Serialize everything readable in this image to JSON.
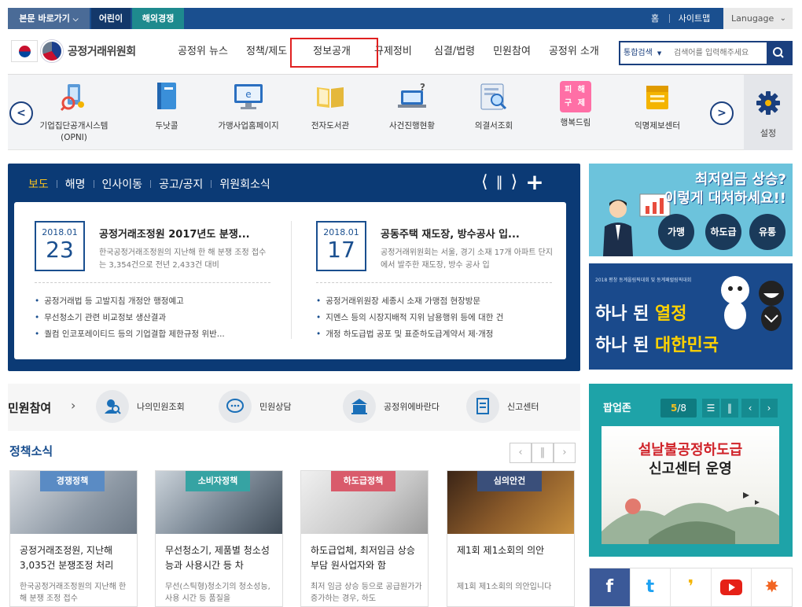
{
  "topbar": {
    "skip_label": "본문 바로가기",
    "kids_label": "어린이",
    "overseas_label": "해외경쟁",
    "home_label": "홈",
    "sitemap_label": "사이트맵",
    "language_label": "Lanugage"
  },
  "header": {
    "logo_text": "공정거래위원회",
    "nav": [
      "공정위 뉴스",
      "정책/제도",
      "정보공개",
      "규제정비",
      "심결/법령",
      "민원참여",
      "공정위 소개"
    ],
    "highlighted_nav": "정보공개",
    "search": {
      "scope": "통합검색",
      "placeholder": "검색어를 입력해주세요"
    }
  },
  "quick_links": {
    "items": [
      {
        "label": "기업집단공개시스템 (OPNI)",
        "icon": "building-search-icon"
      },
      {
        "label": "두낫콜",
        "icon": "book-icon"
      },
      {
        "label": "가맹사업홈페이지",
        "icon": "monitor-icon"
      },
      {
        "label": "전자도서관",
        "icon": "open-book-icon"
      },
      {
        "label": "사건진행현황",
        "icon": "laptop-question-icon"
      },
      {
        "label": "의결서조회",
        "icon": "document-search-icon"
      },
      {
        "label": "행복드림",
        "icon": "relief-icon",
        "glyph": "피 해 구 제"
      },
      {
        "label": "익명제보센터",
        "icon": "folder-icon"
      }
    ],
    "settings_label": "설정"
  },
  "news": {
    "tabs": [
      "보도",
      "해명",
      "인사이동",
      "공고/공지",
      "위원회소식"
    ],
    "active_tab": "보도",
    "articles": [
      {
        "year_month": "2018.01",
        "day": "23",
        "title": "공정거래조정원 2017년도 분쟁...",
        "summary": "한국공정거래조정원의 지난해 한 해 분쟁 조정 접수는 3,354건으로 전년 2,433건 대비",
        "bullets": [
          "공정거래법 등 고발지침 개정안 행정예고",
          "무선청소기 관련 비교정보 생산결과",
          "퀄컴 인코포레이티드 등의 기업결합 제한규정 위반..."
        ]
      },
      {
        "year_month": "2018.01",
        "day": "17",
        "title": "공동주택 재도장, 방수공사 입...",
        "summary": "공정거래위원회는 서울, 경기 소재 17개 아파트 단지에서 발주한 재도장, 방수 공사 입",
        "bullets": [
          "공정거래위원장 세종시 소재 가맹점 현장방문",
          "지멘스 등의 시장지배적 지위 남용행위 등에 대한 건",
          "개정 하도급법 공포 및 표준하도급계약서 제·개정"
        ]
      }
    ]
  },
  "banner_wage": {
    "line1": "최저임금 상승?",
    "line2": "이렇게 대처하세요!!",
    "buttons": [
      "가맹",
      "하도급",
      "유통"
    ]
  },
  "banner_olympic": {
    "small_text": "2018 평창 동계올림픽대회 및 동계패럴림픽대회",
    "line1_prefix": "하나 된 ",
    "line1_highlight": "열정",
    "line2_prefix": "하나 된 ",
    "line2_highlight": "대한민국"
  },
  "civic": {
    "title": "민원참여",
    "items": [
      {
        "label": "나의민원조회",
        "icon": "person-search-icon"
      },
      {
        "label": "민원상담",
        "icon": "speech-bubble-icon"
      },
      {
        "label": "공정위에바란다",
        "icon": "building-icon"
      },
      {
        "label": "신고센터",
        "icon": "report-icon"
      }
    ]
  },
  "policy": {
    "title": "정책소식",
    "cards": [
      {
        "badge": "경쟁정책",
        "title": "공정거래조정원, 지난해 3,035건 분쟁조정 처리",
        "desc": "한국공정거래조정원의 지난해 한 해 분쟁 조정 접수"
      },
      {
        "badge": "소비자정책",
        "title": "무선청소기, 제품별 청소성능과 사용시간 등 차",
        "desc": "무선(스틱형)청소기의 청소성능, 사용 시간 등 품질을"
      },
      {
        "badge": "하도급정책",
        "title": "하도급업체, 최저임금 상승 부담 원사업자와 함",
        "desc": "최저 임금 상승 등으로 공급원가가 증가하는 경우, 하도"
      },
      {
        "badge": "심의안건",
        "title": "제1회 제1소회의 의안",
        "desc": "제1회 제1소회의 의안입니다"
      }
    ]
  },
  "popup_zone": {
    "title": "팝업존",
    "current": "5",
    "total": "/8",
    "line1": "설날불공정하도급",
    "line2": "신고센터 운영"
  },
  "social": [
    "facebook-icon",
    "twitter-icon",
    "kakaostory-icon",
    "youtube-icon",
    "blog-icon"
  ]
}
